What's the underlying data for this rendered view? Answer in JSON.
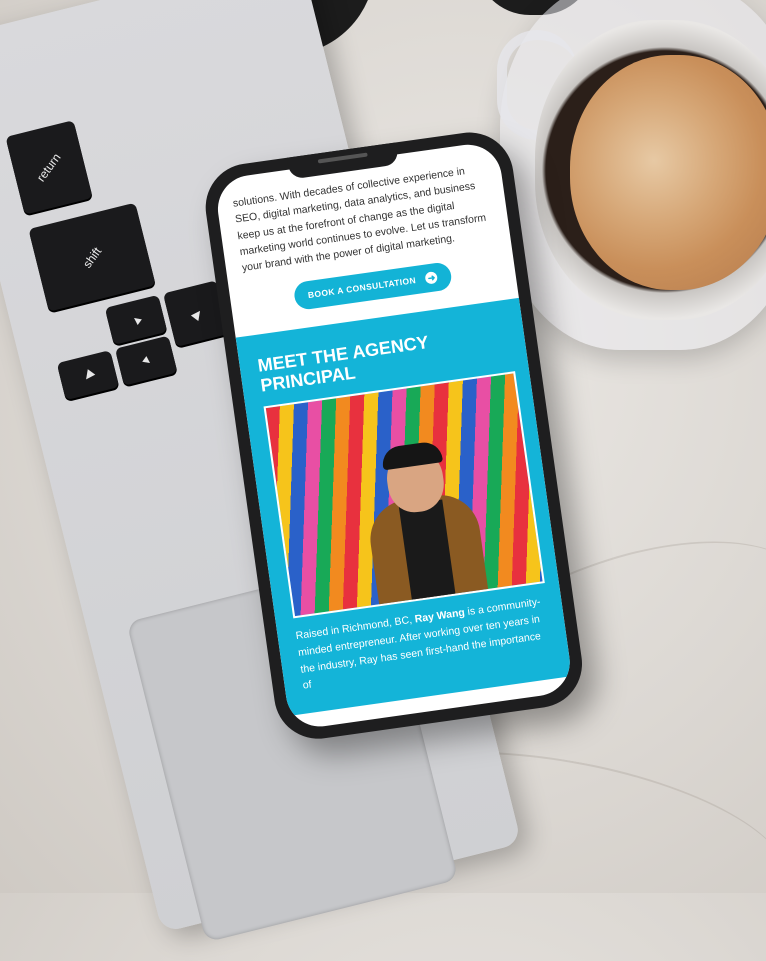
{
  "phone_screen": {
    "intro_text": "solutions. With decades of collective experience in SEO, digital marketing, data analytics, and business keep us at the forefront of change as the digital marketing world continues to evolve. Let us transform your brand with the power of digital marketing.",
    "cta_label": "BOOK A CONSULTATION",
    "section_title": "MEET THE AGENCY PRINCIPAL",
    "bio_prefix": "Raised in Richmond, BC, ",
    "bio_name": "Ray Wang",
    "bio_suffix": " is a community-minded entrepreneur. After working over ten years in the industry, Ray has seen first-hand the importance of"
  },
  "keyboard": {
    "return_label": "return",
    "shift_label": "shift",
    "up_arrow": "▲",
    "down_arrow": "▼",
    "left_arrow": "◀",
    "right_arrow": "▶"
  },
  "colors": {
    "accent": "#14b4d8",
    "phone_body": "#1e1e1f"
  },
  "icons": [
    "arrow-right-icon"
  ]
}
